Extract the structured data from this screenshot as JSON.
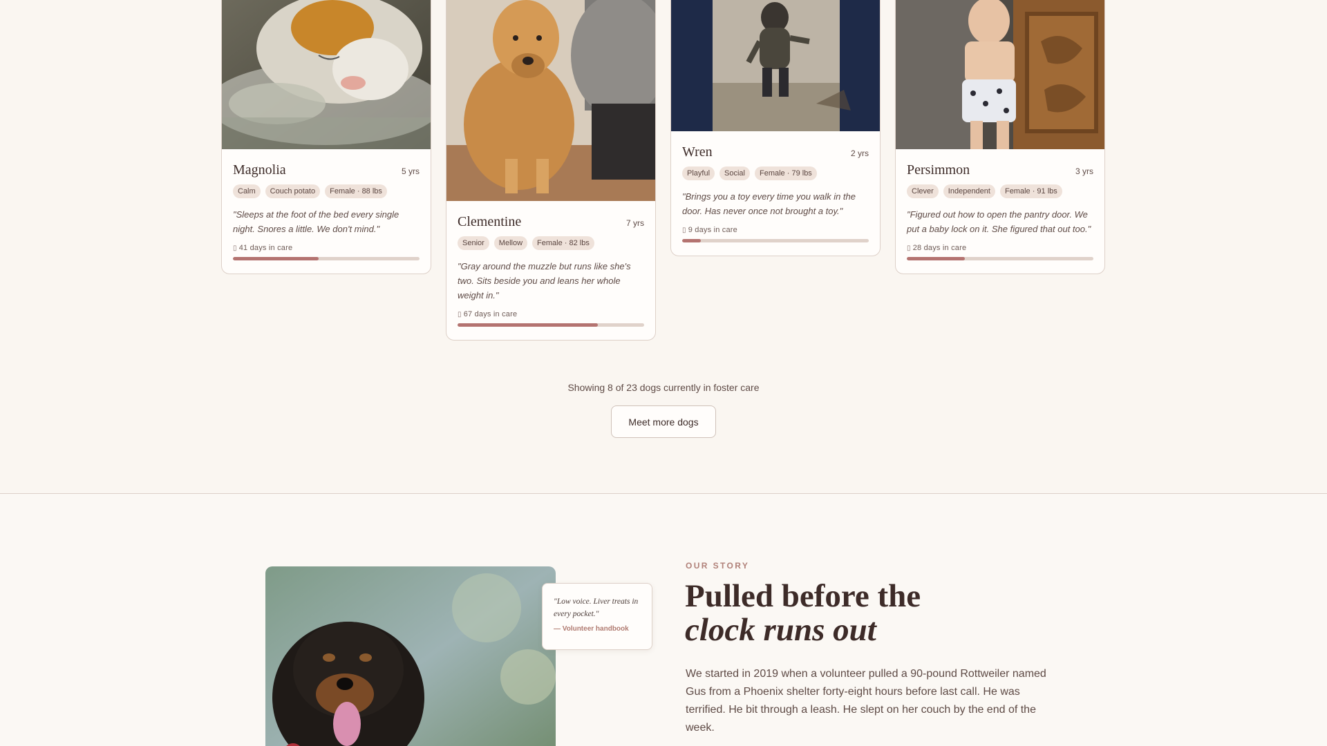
{
  "dogs": [
    {
      "name": "Magnolia",
      "age": "5 yrs",
      "tags": [
        "Calm",
        "Couch potato",
        "Female · 88 lbs"
      ],
      "quote": "\"Sleeps at the foot of the bed every single night. Snores a little. We don't mind.\"",
      "care": "41 days in care",
      "care_progress": 0.46
    },
    {
      "name": "Clementine",
      "age": "7 yrs",
      "tags": [
        "Senior",
        "Mellow",
        "Female · 82 lbs"
      ],
      "quote": "\"Gray around the muzzle but runs like she's two. Sits beside you and leans her whole weight in.\"",
      "care": "67 days in care",
      "care_progress": 0.75
    },
    {
      "name": "Wren",
      "age": "2 yrs",
      "tags": [
        "Playful",
        "Social",
        "Female · 79 lbs"
      ],
      "quote": "\"Brings you a toy every time you walk in the door. Has never once not brought a toy.\"",
      "care": "9 days in care",
      "care_progress": 0.1
    },
    {
      "name": "Persimmon",
      "age": "3 yrs",
      "tags": [
        "Clever",
        "Independent",
        "Female · 91 lbs"
      ],
      "quote": "\"Figured out how to open the pantry door. We put a baby lock on it. She figured that out too.\"",
      "care": "28 days in care",
      "care_progress": 0.31
    }
  ],
  "listing": {
    "showing": "Showing 8 of 23 dogs currently in foster care",
    "more_button": "Meet more dogs"
  },
  "story": {
    "eyebrow": "OUR STORY",
    "title_line1": "Pulled before the",
    "title_line2": "clock runs out",
    "body": "We started in 2019 when a volunteer pulled a 90-pound Rottweiler named Gus from a Phoenix shelter forty-eight hours before last call. He was terrified. He bit through a leash. He slept on her couch by the end of the week.",
    "quote_text": "\"Low voice. Liver treats in every pocket.\"",
    "quote_by": "— Volunteer handbook"
  },
  "icons": {
    "care": "calendar-icon"
  },
  "colors": {
    "accent": "#b47370",
    "background": "#faf6f1",
    "tag": "#efe2da"
  }
}
